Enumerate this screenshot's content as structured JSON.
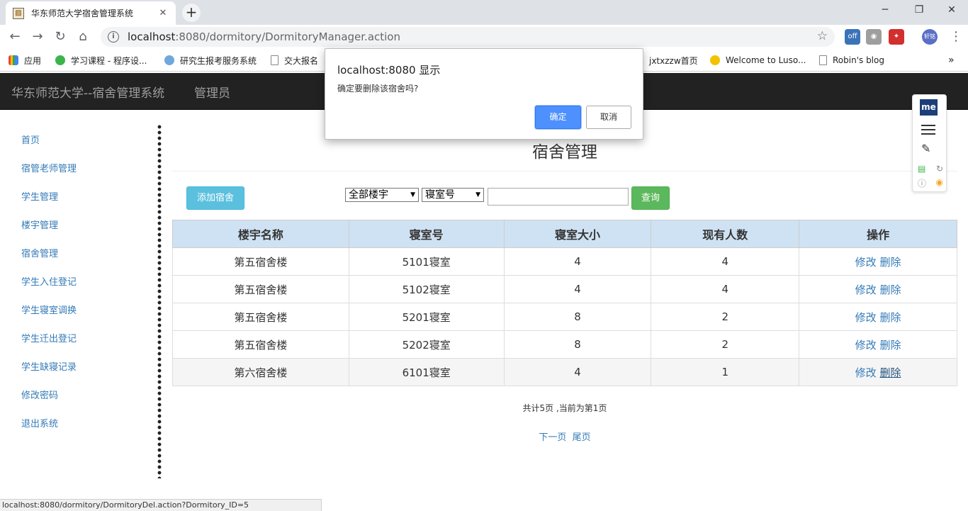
{
  "browser": {
    "tab_title": "华东师范大学宿舍管理系统",
    "tab_close": "✕",
    "new_tab": "+",
    "url_host": "localhost",
    "url_rest": ":8080/dormitory/DormitoryManager.action",
    "info_glyph": "i",
    "star_glyph": "☆",
    "ext_off_label": "off",
    "ext_user_label": "轩铭",
    "bookmarks": [
      {
        "label": "应用",
        "icon": "apps-grid-icon",
        "color": "#e8453c"
      },
      {
        "label": "学习课程 - 程序设...",
        "icon": "green-bookmark-icon",
        "color": "#3bb54a"
      },
      {
        "label": "研究生报考服务系统",
        "icon": "gear-bookmark-icon",
        "color": "#6ea8dc"
      },
      {
        "label": "交大报名",
        "icon": "page-icon",
        "color": "#888888"
      },
      {
        "label": "jxtxzzw首页",
        "icon": "site-bookmark-icon",
        "color": "#b5651d"
      },
      {
        "label": "Welcome to Luso...",
        "icon": "star-bookmark-icon",
        "color": "#f2c200"
      },
      {
        "label": "Robin's blog",
        "icon": "page-icon",
        "color": "#888888"
      }
    ],
    "bookmarks_overflow": "»",
    "status_url": "localhost:8080/dormitory/DormitoryDel.action?Dormitory_ID=5"
  },
  "app": {
    "brand": "华东师范大学--宿舍管理系统",
    "role": "管理员"
  },
  "sidebar": {
    "items": [
      {
        "label": "首页"
      },
      {
        "label": "宿管老师管理"
      },
      {
        "label": "学生管理"
      },
      {
        "label": "楼宇管理"
      },
      {
        "label": "宿舍管理"
      },
      {
        "label": "学生入住登记"
      },
      {
        "label": "学生寝室调换"
      },
      {
        "label": "学生迁出登记"
      },
      {
        "label": "学生缺寝记录"
      },
      {
        "label": "修改密码"
      },
      {
        "label": "退出系统"
      }
    ]
  },
  "main": {
    "title": "宿舍管理",
    "add_button": "添加宿舍",
    "building_select": "全部楼宇",
    "room_select": "寝室号",
    "query_input_value": "",
    "query_button": "查询",
    "table": {
      "headers": [
        "楼宇名称",
        "寝室号",
        "寝室大小",
        "现有人数",
        "操作"
      ],
      "rows": [
        {
          "building": "第五宿舍楼",
          "room": "5101寝室",
          "size": "4",
          "current": "4"
        },
        {
          "building": "第五宿舍楼",
          "room": "5102寝室",
          "size": "4",
          "current": "4"
        },
        {
          "building": "第五宿舍楼",
          "room": "5201寝室",
          "size": "8",
          "current": "2"
        },
        {
          "building": "第五宿舍楼",
          "room": "5202寝室",
          "size": "8",
          "current": "2"
        },
        {
          "building": "第六宿舍楼",
          "room": "6101寝室",
          "size": "4",
          "current": "1"
        }
      ],
      "edit_label": "修改",
      "delete_label": "删除"
    },
    "page_info": "共计5页 ,当前为第1页",
    "next_page": "下一页",
    "last_page": "尾页"
  },
  "panel": {
    "me_label": "me"
  },
  "dialog": {
    "title": "localhost:8080 显示",
    "message": "确定要删除该宿舍吗?",
    "ok": "确定",
    "cancel": "取消"
  },
  "colors": {
    "navbar": "#222222",
    "link": "#337ab7",
    "header_bg": "#cfe2f3",
    "add_btn": "#5bc0de",
    "query_btn": "#5cb85c",
    "dialog_ok": "#4d90fe"
  }
}
